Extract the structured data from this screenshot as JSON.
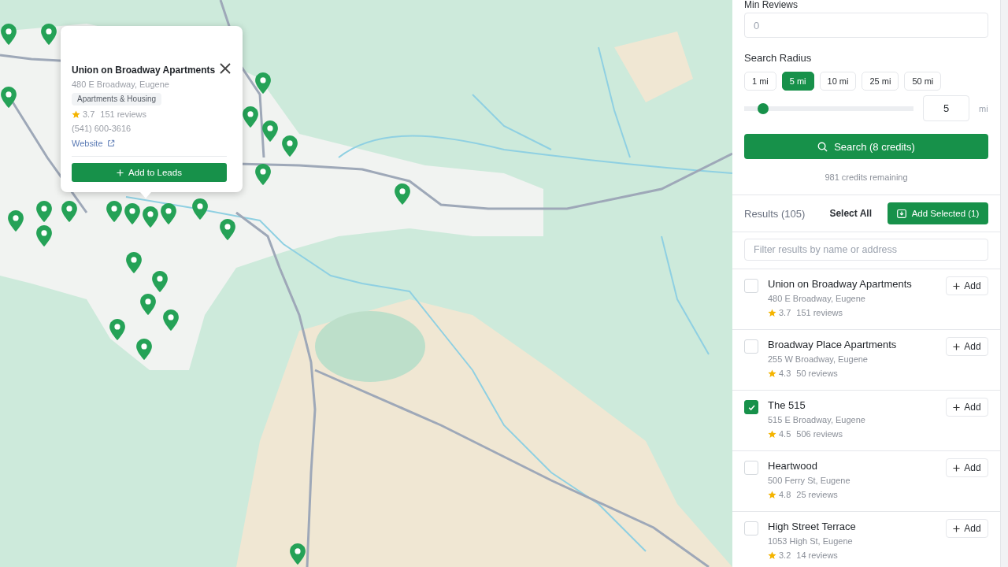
{
  "map": {
    "popup": {
      "title": "Union on Broadway Apartments",
      "address": "480 E Broadway, Eugene",
      "category": "Apartments & Housing",
      "rating": "3.7",
      "reviews": "151 reviews",
      "phone": "(541) 600-3616",
      "website": "Website",
      "button": "Add to Leads"
    }
  },
  "filters": {
    "min_reviews": {
      "label": "Min Reviews",
      "placeholder": "0"
    },
    "radius": {
      "label": "Search Radius",
      "options": [
        {
          "label": "1 mi",
          "selected": false
        },
        {
          "label": "5 mi",
          "selected": true
        },
        {
          "label": "10 mi",
          "selected": false
        },
        {
          "label": "25 mi",
          "selected": false
        },
        {
          "label": "50 mi",
          "selected": false
        }
      ],
      "level": 0.08,
      "value": "5",
      "unit": "mi"
    },
    "search_button": "Search (8 credits)",
    "credits": "981 credits remaining"
  },
  "results": {
    "title": "Results (105)",
    "select_all": "Select All",
    "add_selected": "Add Selected (1)",
    "filter": {
      "placeholder": "Filter results by name or address"
    },
    "items": [
      {
        "name": "Union on Broadway Apartments",
        "address": "480 E Broadway, Eugene",
        "rating": "3.7",
        "reviews": "151 reviews",
        "checked": false,
        "action": "Add"
      },
      {
        "name": "Broadway Place Apartments",
        "address": "255 W Broadway, Eugene",
        "rating": "4.3",
        "reviews": "50 reviews",
        "checked": false,
        "action": "Add"
      },
      {
        "name": "The 515",
        "address": "515 E Broadway, Eugene",
        "rating": "4.5",
        "reviews": "506 reviews",
        "checked": true,
        "action": "Add"
      },
      {
        "name": "Heartwood",
        "address": "500 Ferry St, Eugene",
        "rating": "4.8",
        "reviews": "25 reviews",
        "checked": false,
        "action": "Add"
      },
      {
        "name": "High Street Terrace",
        "address": "1053 High St, Eugene",
        "rating": "3.2",
        "reviews": "14 reviews",
        "checked": false,
        "action": "Add"
      }
    ]
  }
}
